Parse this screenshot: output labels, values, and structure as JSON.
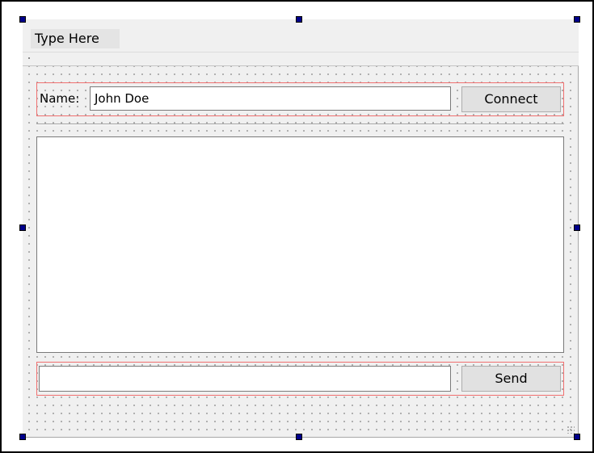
{
  "menubar": {
    "items": [
      {
        "label": "Type Here"
      }
    ]
  },
  "connection": {
    "name_label": "Name:",
    "name_value": "John Doe",
    "connect_label": "Connect"
  },
  "chat": {
    "messages": []
  },
  "composer": {
    "message_value": "",
    "send_label": "Send"
  },
  "colors": {
    "form_background": "#f0f0f0",
    "layout_outline": "#f07070",
    "selection_handle": "#00008b",
    "button_face": "#e1e1e1"
  },
  "icons": [
    "selection-handle-icon",
    "resize-grip-icon",
    "toolbar-grip-icon"
  ]
}
